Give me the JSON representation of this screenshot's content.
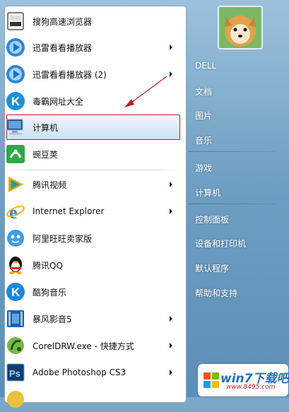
{
  "programs": [
    {
      "label": "搜狗高速浏览器",
      "icon": "sogou-browser-icon",
      "submenu": false
    },
    {
      "label": "迅雷看看播放器",
      "icon": "xunlei-player-icon",
      "submenu": true
    },
    {
      "label": "迅雷看看播放器 (2)",
      "icon": "xunlei-player-icon",
      "submenu": true
    },
    {
      "label": "毒霸网址大全",
      "icon": "duba-k-icon",
      "submenu": false
    },
    {
      "label": "计算机",
      "icon": "computer-icon",
      "submenu": false,
      "highlighted": true
    },
    {
      "label": "豌豆荚",
      "icon": "wandoujia-icon",
      "submenu": false
    },
    {
      "label": "腾讯视频",
      "icon": "tencent-video-icon",
      "submenu": true
    },
    {
      "label": "Internet Explorer",
      "icon": "internet-explorer-icon",
      "submenu": true
    },
    {
      "label": "阿里旺旺卖家版",
      "icon": "aliwangwang-icon",
      "submenu": false
    },
    {
      "label": "腾讯QQ",
      "icon": "qq-penguin-icon",
      "submenu": false
    },
    {
      "label": "酷狗音乐",
      "icon": "kugou-k-icon",
      "submenu": false
    },
    {
      "label": "暴风影音5",
      "icon": "baofeng-film-icon",
      "submenu": true
    },
    {
      "label": "CorelDRW.exe - 快捷方式",
      "icon": "coreldraw-icon",
      "submenu": true
    },
    {
      "label": "Adobe Photoshop CS3",
      "icon": "photoshop-icon",
      "submenu": true
    }
  ],
  "right": {
    "user": "DELL",
    "links": [
      "文档",
      "图片",
      "音乐",
      "游戏",
      "计算机",
      "控制面板",
      "设备和打印机",
      "默认程序",
      "帮助和支持"
    ]
  },
  "watermark": {
    "main": "win7下载吧",
    "sub": "www.8495.com"
  },
  "colors": {
    "highlight_border": "#c0202a",
    "arrow": "#c0202a"
  }
}
